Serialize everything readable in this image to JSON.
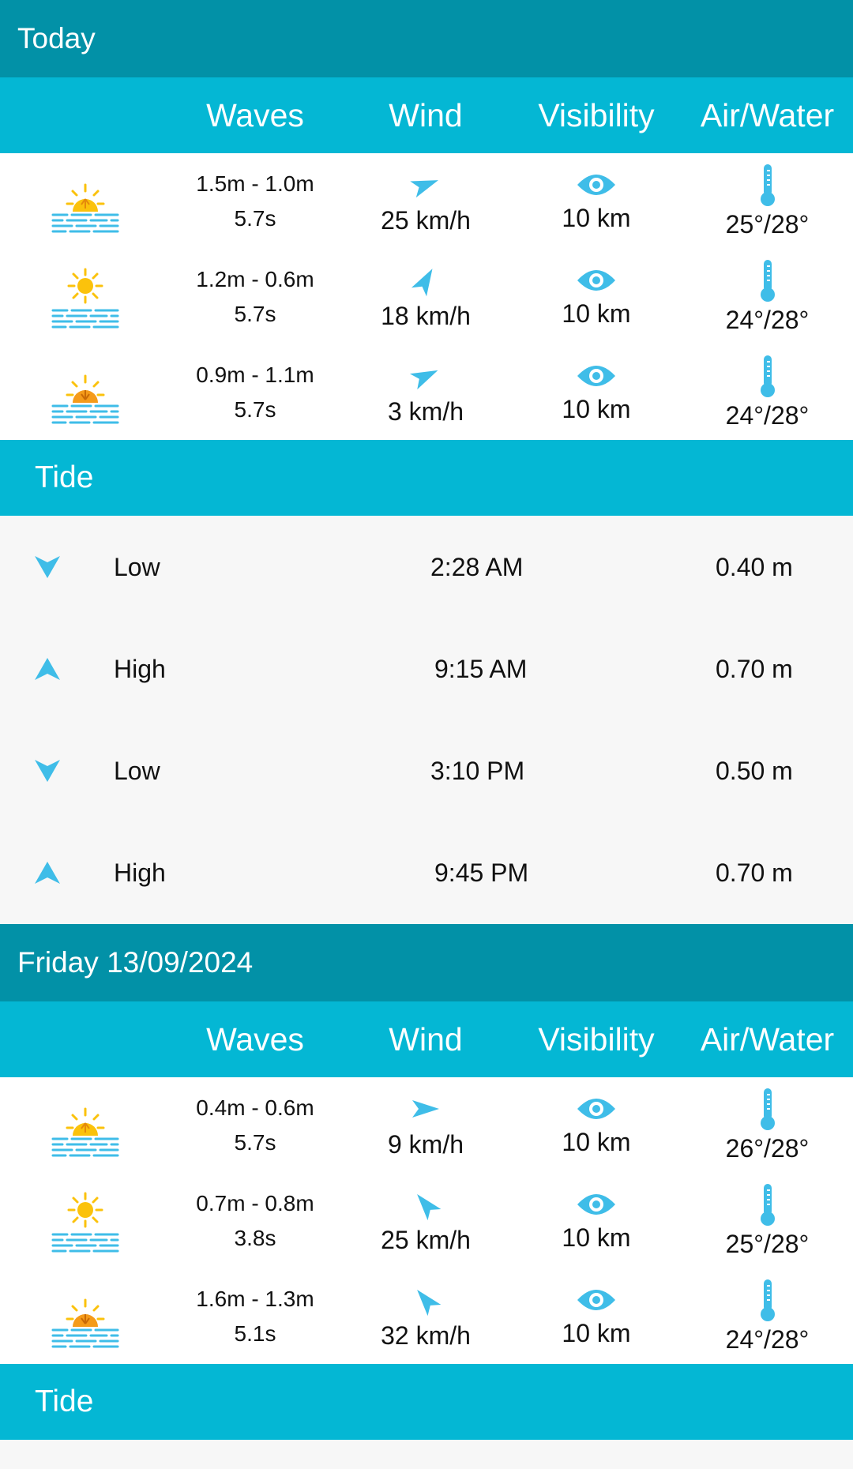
{
  "colors": {
    "header_dark": "#0291a7",
    "header_light": "#04b7d4",
    "accent": "#3fbde8",
    "sun": "#fbc20c"
  },
  "columns": [
    "Waves",
    "Wind",
    "Visibility",
    "Air/Water"
  ],
  "days": [
    {
      "title": "Today",
      "forecast": [
        {
          "icon": "sunrise-sea-icon",
          "waves_height": "1.5m - 1.0m",
          "waves_period": "5.7s",
          "wind_icon": "wind-direction-arrow-icon",
          "wind": "25 km/h",
          "visibility": "10 km",
          "air_water": "25°/28°"
        },
        {
          "icon": "sun-sea-icon",
          "waves_height": "1.2m - 0.6m",
          "waves_period": "5.7s",
          "wind_icon": "wind-direction-arrow-icon",
          "wind": "18 km/h",
          "visibility": "10 km",
          "air_water": "24°/28°"
        },
        {
          "icon": "sunset-sea-icon",
          "waves_height": "0.9m - 1.1m",
          "waves_period": "5.7s",
          "wind_icon": "wind-direction-arrow-icon",
          "wind": "3 km/h",
          "visibility": "10 km",
          "air_water": "24°/28°"
        }
      ],
      "tide_title": "Tide",
      "tides": [
        {
          "type": "Low",
          "time": "2:28 AM",
          "height": "0.40 m"
        },
        {
          "type": "High",
          "time": "9:15 AM",
          "height": "0.70 m"
        },
        {
          "type": "Low",
          "time": "3:10 PM",
          "height": "0.50 m"
        },
        {
          "type": "High",
          "time": "9:45 PM",
          "height": "0.70 m"
        }
      ]
    },
    {
      "title": "Friday 13/09/2024",
      "forecast": [
        {
          "icon": "sunrise-sea-icon",
          "waves_height": "0.4m - 0.6m",
          "waves_period": "5.7s",
          "wind_icon": "wind-direction-arrow-icon",
          "wind": "9 km/h",
          "visibility": "10 km",
          "air_water": "26°/28°"
        },
        {
          "icon": "sun-sea-icon",
          "waves_height": "0.7m - 0.8m",
          "waves_period": "3.8s",
          "wind_icon": "wind-direction-arrow-icon",
          "wind": "25 km/h",
          "visibility": "10 km",
          "air_water": "25°/28°"
        },
        {
          "icon": "sunset-sea-icon",
          "waves_height": "1.6m - 1.3m",
          "waves_period": "5.1s",
          "wind_icon": "wind-direction-arrow-icon",
          "wind": "32 km/h",
          "visibility": "10 km",
          "air_water": "24°/28°"
        }
      ],
      "tide_title": "Tide"
    }
  ]
}
